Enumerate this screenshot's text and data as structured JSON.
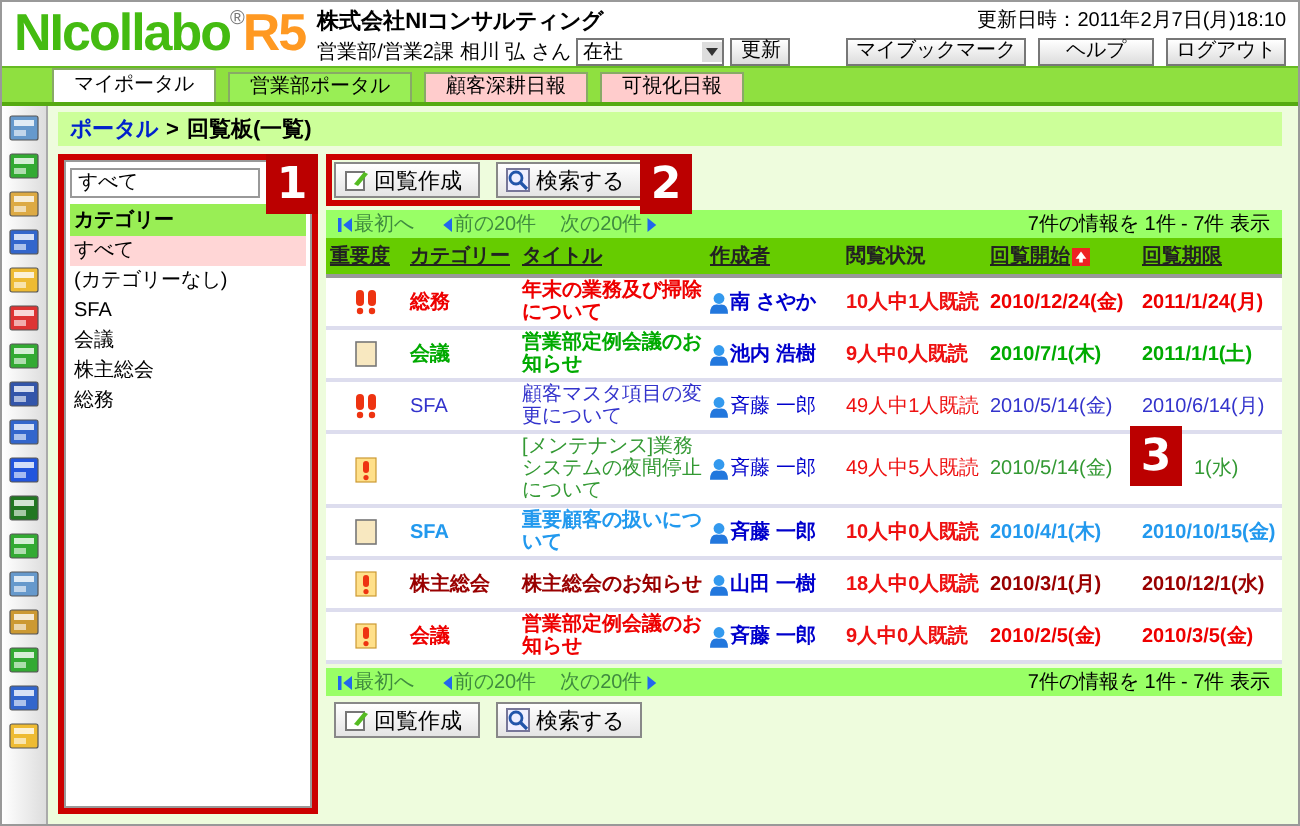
{
  "logo": {
    "name": "NIcollabo",
    "mark": "®",
    "version": "R5"
  },
  "company": "株式会社NIコンサルティング",
  "user": {
    "label": "営業部/営業2課 相川 弘 さん",
    "status": "在社",
    "update_button": "更新"
  },
  "updated": "更新日時：2011年2月7日(月)18:10",
  "header_buttons": [
    "マイブックマーク",
    "ヘルプ",
    "ログアウト"
  ],
  "tabs": [
    {
      "label": "マイポータル",
      "selected": true
    },
    {
      "label": "営業部ポータル",
      "selected": false,
      "color": "#99ee55"
    },
    {
      "label": "顧客深耕日報",
      "selected": false,
      "color": "#ffcccc"
    },
    {
      "label": "可視化日報",
      "selected": false,
      "color": "#ffcccc"
    }
  ],
  "breadcrumb": {
    "link": "ポータル",
    "separator": ">",
    "current": "回覧板(一覧)"
  },
  "category_panel": {
    "search_value": "すべて",
    "heading": "カテゴリー",
    "items": [
      {
        "label": "すべて",
        "selected": true
      },
      {
        "label": "(カテゴリーなし)",
        "selected": false
      },
      {
        "label": "SFA",
        "selected": false
      },
      {
        "label": "会議",
        "selected": false
      },
      {
        "label": "株主総会",
        "selected": false
      },
      {
        "label": "総務",
        "selected": false
      }
    ]
  },
  "toolbar_top": [
    "回覧作成",
    "検索する"
  ],
  "pager_top": {
    "links": [
      {
        "label": "最初へ",
        "disabled": true
      },
      {
        "label": "前の20件",
        "disabled": true
      },
      {
        "label": "次の20件",
        "disabled": true
      }
    ],
    "summary": "7件の情報を 1件 - 7件 表示"
  },
  "table": {
    "columns": [
      {
        "label": "重要度",
        "sortable": true,
        "sorted": false
      },
      {
        "label": "カテゴリー",
        "sortable": true,
        "sorted": false
      },
      {
        "label": "タイトル",
        "sortable": true,
        "sorted": false
      },
      {
        "label": "作成者",
        "sortable": true,
        "sorted": false
      },
      {
        "label": "閲覧状況",
        "sortable": false,
        "sorted": false
      },
      {
        "label": "回覧開始",
        "sortable": true,
        "sorted": true
      },
      {
        "label": "回覧期限",
        "sortable": true,
        "sorted": false
      }
    ],
    "rows": [
      {
        "kind": "high",
        "category": "総務",
        "title": "年末の業務及び掃除について",
        "author": "南 さやか",
        "status": "10人中1人既読",
        "start": "2010/12/24(金)",
        "deadline": "2011/1/24(月)",
        "color": "#ee0000",
        "bold": true
      },
      {
        "kind": "low",
        "category": "会議",
        "title": "営業部定例会議のお知らせ",
        "author": "池内 浩樹",
        "status": "9人中0人既読",
        "start": "2010/7/1(木)",
        "deadline": "2011/1/1(土)",
        "color": "#00aa00",
        "bold": true
      },
      {
        "kind": "high",
        "category": "SFA",
        "title": "顧客マスタ項目の変更について",
        "author": "斉藤 一郎",
        "status": "49人中1人既読",
        "start": "2010/5/14(金)",
        "deadline": "2010/6/14(月)",
        "color": "#3333cc",
        "bold": false
      },
      {
        "kind": "medium",
        "title": "[メンテナンス]業務システムの夜間停止について",
        "author": "斉藤 一郎",
        "status": "49人中5人既読",
        "start": "2010/5/14(金)",
        "deadline": "1(水)",
        "color": "#339933",
        "bold": false
      },
      {
        "kind": "low",
        "category": "SFA",
        "title": "重要顧客の扱いについて",
        "author": "斉藤 一郎",
        "status": "10人中0人既読",
        "start": "2010/4/1(木)",
        "deadline": "2010/10/15(金)",
        "color": "#2299ee",
        "bold": true
      },
      {
        "kind": "medium",
        "category": "株主総会",
        "title": "株主総会のお知らせ",
        "author": "山田 一樹",
        "status": "18人中0人既読",
        "start": "2010/3/1(月)",
        "deadline": "2010/12/1(水)",
        "color": "#990000",
        "bold": true
      },
      {
        "kind": "medium",
        "category": "会議",
        "title": "営業部定例会議のお知らせ",
        "author": "斉藤 一郎",
        "status": "9人中0人既読",
        "start": "2010/2/5(金)",
        "deadline": "2010/3/5(金)",
        "color": "#ee0000",
        "bold": true
      }
    ]
  },
  "pager_bottom": {
    "links": [
      {
        "label": "最初へ",
        "disabled": true
      },
      {
        "label": "前の20件",
        "disabled": true
      },
      {
        "label": "次の20件",
        "disabled": true
      }
    ],
    "summary": "7件の情報を 1件 - 7件 表示"
  },
  "toolbar_bottom": [
    "回覧作成",
    "検索する"
  ],
  "callouts": [
    {
      "label": "1"
    },
    {
      "label": "2"
    },
    {
      "label": "3"
    }
  ]
}
